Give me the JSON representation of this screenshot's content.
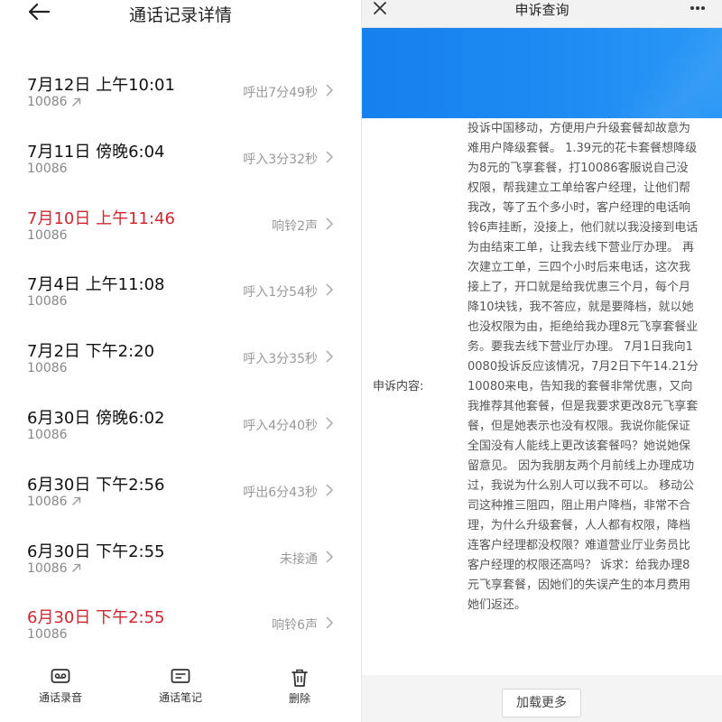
{
  "left": {
    "title": "通话记录详情",
    "calls": [
      {
        "date": "7月12日 上午10:01",
        "number": "10086",
        "outgoing": true,
        "status": "呼出7分49秒",
        "missed": false
      },
      {
        "date": "7月11日 傍晚6:04",
        "number": "10086",
        "outgoing": false,
        "status": "呼入3分32秒",
        "missed": false
      },
      {
        "date": "7月10日 上午11:46",
        "number": "10086",
        "outgoing": false,
        "status": "响铃2声",
        "missed": true
      },
      {
        "date": "7月4日 上午11:08",
        "number": "10086",
        "outgoing": false,
        "status": "呼入1分54秒",
        "missed": false
      },
      {
        "date": "7月2日 下午2:20",
        "number": "10086",
        "outgoing": false,
        "status": "呼入3分35秒",
        "missed": false
      },
      {
        "date": "6月30日 傍晚6:02",
        "number": "10086",
        "outgoing": false,
        "status": "呼入4分40秒",
        "missed": false
      },
      {
        "date": "6月30日 下午2:56",
        "number": "10086",
        "outgoing": true,
        "status": "呼出6分43秒",
        "missed": false
      },
      {
        "date": "6月30日 下午2:55",
        "number": "10086",
        "outgoing": true,
        "status": "未接通",
        "missed": false
      },
      {
        "date": "6月30日 下午2:55",
        "number": "10086",
        "outgoing": false,
        "status": "响铃6声",
        "missed": true
      }
    ],
    "toolbar": {
      "recording_label": "通话录音",
      "notes_label": "通话笔记",
      "delete_label": "删除"
    }
  },
  "right": {
    "title": "申诉查询",
    "field_label": "申诉内容:",
    "complaint_text": "投诉中国移动，方便用户升级套餐却故意为难用户降级套餐。 1.39元的花卡套餐想降级为8元的飞享套餐，打10086客服说自己没权限，帮我建立工单给客户经理，让他们帮我改，等了五个多小时，客户经理的电话响铃6声挂断，没接上，他们就以我没接到电话为由结束工单，让我去线下营业厅办理。 再次建立工单，三四个小时后来电话，这次我接上了，开口就是给我优惠三个月，每个月降10块钱，我不答应，就是要降档，就以她也没权限为由，拒绝给我办理8元飞享套餐业务。要我去线下营业厅办理。 7月1日我向10080投诉反应该情况，7月2日下午14.21分10080来电，告知我的套餐非常优惠，又向我推荐其他套餐，但是我要求更改8元飞享套餐，但是她表示也没有权限。我说你能保证全国没有人能线上更改该套餐吗？她说她保留意见。 因为我朋友两个月前线上办理成功过，我说为什么别人可以我不可以。 移动公司这种推三阻四，阻止用户降档，非常不合理，为什么升级套餐，人人都有权限，降档连客户经理都没权限？难道营业厅业务员比客户经理的权限还高吗？ 诉求：给我办理8元飞享套餐，因她们的失误产生的本月费用她们返还。",
    "load_more_label": "加载更多"
  },
  "colors": {
    "missed": "#d0262f",
    "banner": "#1e8cf3"
  }
}
